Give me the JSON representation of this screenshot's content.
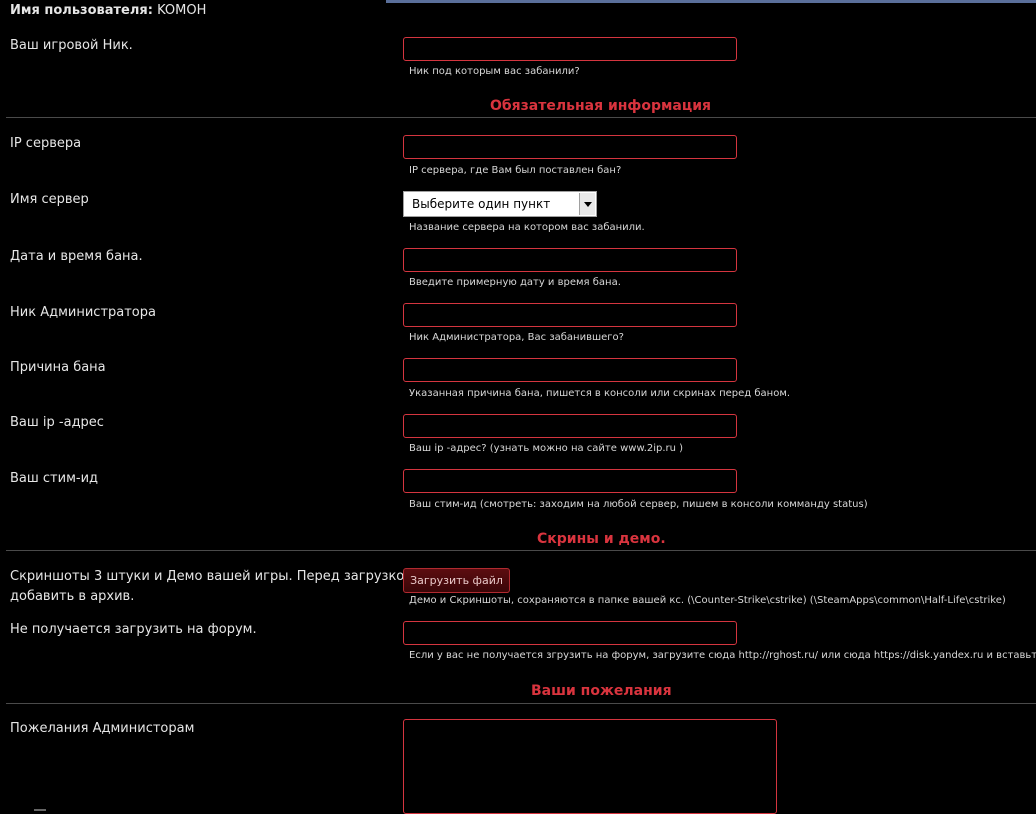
{
  "user": {
    "label": "Имя пользователя:",
    "value": "KOMOH"
  },
  "fields": {
    "nick": {
      "label": "Ваш игровой Ник.",
      "hint": "Ник под которым вас забанили?",
      "value": ""
    },
    "server_ip": {
      "label": "IP сервера",
      "hint": "IP сервера, где Вам был поставлен бан?",
      "value": ""
    },
    "server_name": {
      "label": "Имя сервер",
      "hint": "Название сервера на котором вас забанили.",
      "selected": "Выберите один пункт"
    },
    "ban_datetime": {
      "label": "Дата и время бана.",
      "hint": "Введите примерную дату и время бана.",
      "value": ""
    },
    "admin_nick": {
      "label": "Ник Администратора",
      "hint": "Ник Администратора, Вас забанившего?",
      "value": ""
    },
    "ban_reason": {
      "label": "Причина бана",
      "hint": "Указанная причина бана, пишется в консоли или скринах перед баном.",
      "value": ""
    },
    "your_ip": {
      "label": "Ваш ip -адрес",
      "hint": "Ваш ip -адрес? (узнать можно на сайте www.2ip.ru )",
      "value": ""
    },
    "steam_id": {
      "label": "Ваш стим-ид",
      "hint": "Ваш стим-ид (смотреть: заходим на любой сервер, пишем в консоли комманду status)",
      "value": ""
    },
    "screens": {
      "label_line1": "Скриншоты 3 штуки и Демо вашей игры. Перед загрузкой",
      "label_line2": "добавить в архив.",
      "button": "Загрузить файл",
      "hint": "Демо и Скриншоты, сохраняются в папке вашей кс. (\\Counter-Strike\\cstrike) (\\SteamApps\\common\\Half-Life\\cstrike)"
    },
    "forum_upload": {
      "label": "Не получается загрузить на форум.",
      "hint": "Если у вас не получается згрузить на форум, загрузите сюда http://rghost.ru/ или сюда https://disk.yandex.ru и вставьте ссыл",
      "value": ""
    },
    "wishes": {
      "label": "Пожелания Администорам",
      "value": ""
    }
  },
  "sections": {
    "required": "Обязательная информация",
    "screens": "Скрины и демо.",
    "wishes": "Ваши пожелания"
  },
  "colors": {
    "accent": "#d9343e",
    "background": "#000000",
    "text": "#e6e6e6"
  }
}
